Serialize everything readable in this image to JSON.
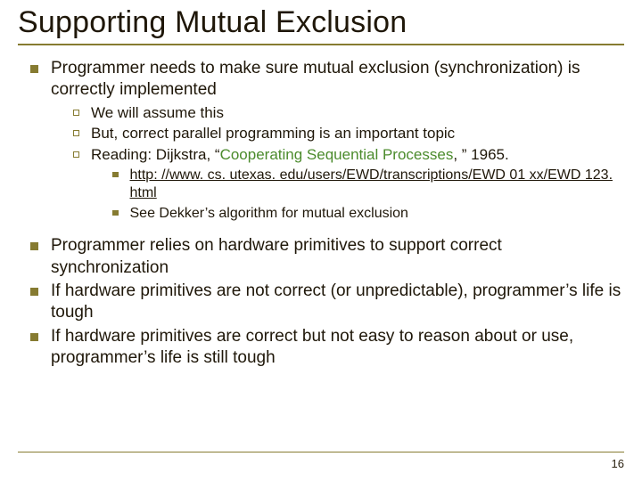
{
  "title": "Supporting Mutual Exclusion",
  "bullets": {
    "b1": "Programmer needs to make sure mutual exclusion (synchronization) is correctly implemented",
    "b1_1": "We will assume this",
    "b1_2": "But, correct parallel programming is an important topic",
    "b1_3a": "Reading: Dijkstra, “",
    "b1_3_paper": "Cooperating Sequential Processes",
    "b1_3b": ", ” 1965.",
    "b1_3_1": "http: //www. cs. utexas. edu/users/EWD/transcriptions/EWD 01 xx/EWD 123. html",
    "b1_3_2": "See Dekker’s algorithm for mutual exclusion",
    "b2": "Programmer relies on hardware primitives to support correct synchronization",
    "b3": "If hardware primitives are not correct (or unpredictable), programmer’s life is tough",
    "b4": "If hardware primitives are correct but not easy to reason about or use, programmer’s life is still tough"
  },
  "page_number": "16"
}
